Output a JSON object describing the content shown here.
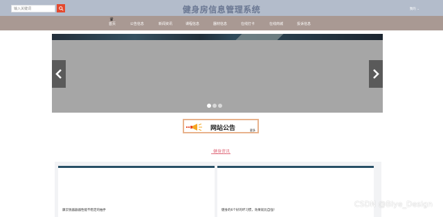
{
  "header": {
    "search_placeholder": "输入关键词",
    "title": "健身房信息管理系统",
    "user_menu": "我的 ⌄"
  },
  "nav": {
    "items": [
      {
        "label": "首页"
      },
      {
        "label": "公告信息"
      },
      {
        "label": "新闻资讯"
      },
      {
        "label": "课程信息"
      },
      {
        "label": "器材信息"
      },
      {
        "label": "在线打卡"
      },
      {
        "label": "在线商城"
      },
      {
        "label": "投诉信息"
      }
    ]
  },
  "banner": {
    "slide_count": 3,
    "active_slide": 1
  },
  "notice": {
    "title": "网站公告",
    "more": "更多"
  },
  "section": {
    "title": "健身资讯"
  },
  "cards": [
    {
      "text": "康云锐器器器性能不稳定的抽手"
    },
    {
      "text": "健身的6个好的坏习惯，效果就比自强！"
    }
  ],
  "watermark": "CSDN @Biye_Design",
  "colors": {
    "topbar": "#b3bccb",
    "navbar": "#a99993",
    "search_button": "#e4492e",
    "accent_pink": "#e06c7c",
    "card_border": "#274f66"
  }
}
